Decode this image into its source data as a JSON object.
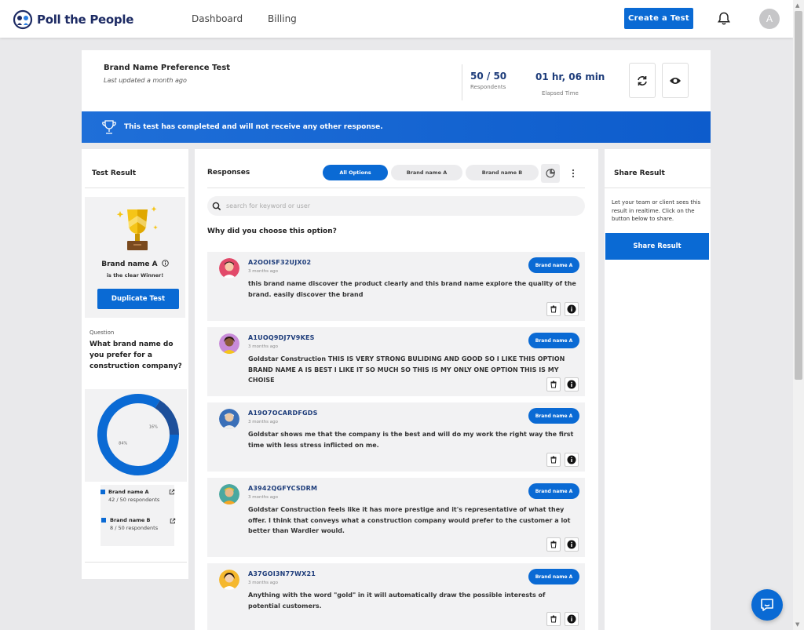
{
  "app": {
    "logo_text": "Poll the People"
  },
  "nav": {
    "dashboard": "Dashboard",
    "billing": "Billing",
    "create_test": "Create a Test",
    "avatar_initial": "A"
  },
  "header": {
    "title": "Brand Name Preference Test",
    "subtitle": "Last updated a month ago",
    "respondents_value": "50 / 50",
    "respondents_label": "Respondents",
    "elapsed_value": "01 hr, 06 min",
    "elapsed_label": "Elapsed Time"
  },
  "banner": {
    "text": "This test has completed and will not receive any other response."
  },
  "left": {
    "title": "Test Result",
    "winner_name": "Brand name A",
    "winner_sub": "is the clear Winner!",
    "duplicate_label": "Duplicate Test",
    "question_label": "Question",
    "question_text": "What brand name do you prefer for a construction company?",
    "legend": [
      {
        "name": "Brand name A",
        "count": "42 / 50 respondents"
      },
      {
        "name": "Brand name B",
        "count": "8 / 50 respondents"
      }
    ]
  },
  "chart_data": {
    "type": "pie",
    "categories": [
      "Brand name A",
      "Brand name B"
    ],
    "values": [
      84,
      16
    ],
    "value_labels": [
      "84%",
      "16%"
    ],
    "colors": [
      "#0a6ad4",
      "#1d4f9a"
    ]
  },
  "middle": {
    "title": "Responses",
    "filters": [
      "All Options",
      "Brand name A",
      "Brand name B"
    ],
    "search_placeholder": "search for keyword or user",
    "question": "Why did you choose this option?",
    "responses": [
      {
        "id": "A2OOISF32UJX02",
        "time": "3 months ago",
        "badge": "Brand name A",
        "text": "this brand name discover the product clearly and this brand name explore the quality of the brand. easily discover the brand"
      },
      {
        "id": "A1UOQ9DJ7V9KES",
        "time": "3 months ago",
        "badge": "Brand name A",
        "text": "Goldstar Construction THIS IS VERY STRONG BULIDING AND GOOD SO I LIKE THIS OPTION BRAND NAME A IS BEST I LIKE IT SO MUCH SO THIS IS MY ONLY ONE OPTION THIS IS MY CHOISE"
      },
      {
        "id": "A19O7OCARDFGDS",
        "time": "3 months ago",
        "badge": "Brand name A",
        "text": "Goldstar shows me that the company is the best and will do my work the right way the first time with less stress inflicted on me."
      },
      {
        "id": "A3942QGFYCSDRM",
        "time": "3 months ago",
        "badge": "Brand name A",
        "text": "Goldstar Construction feels like it has more prestige and it's representative of what they offer. I think that conveys what a construction company would prefer to the customer a lot better than Wardier would."
      },
      {
        "id": "A37GOI3N77WX21",
        "time": "3 months ago",
        "badge": "Brand name A",
        "text": "Anything with the word \"gold\" in it will automatically draw the possible interests of potential customers."
      }
    ]
  },
  "right": {
    "title": "Share Result",
    "description": "Let your team or client sees this result in realtime. Click on the button below to share.",
    "share_label": "Share Result"
  },
  "icons": {
    "logo": "logo-mark",
    "bell": "bell-icon",
    "refresh": "refresh-icon",
    "eye": "eye-icon",
    "trophy": "trophy-icon",
    "info": "info-icon",
    "search": "search-icon",
    "trash": "trash-icon",
    "more": "more-vertical-icon",
    "chat": "chat-icon"
  }
}
